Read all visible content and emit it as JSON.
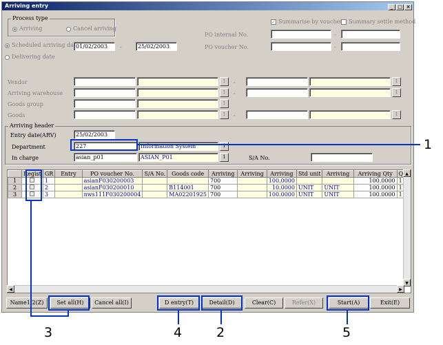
{
  "window": {
    "title": "Arriving entry",
    "controls": {
      "minimize": "_",
      "maximize": "□",
      "close": "×"
    }
  },
  "process_type": {
    "label": "Process type",
    "options": [
      "Arriving",
      "Cancel arriving"
    ],
    "selected": "Arriving"
  },
  "summarise_by_vouchers": {
    "label": "Summarise by vouchers",
    "checked": true
  },
  "summary_settle_method": {
    "label": "Summary settle method",
    "checked": false
  },
  "po_internal_no": {
    "label": "PO internal No.",
    "from": "",
    "to": ""
  },
  "po_voucher_no": {
    "label": "PO voucher No.",
    "from": "",
    "to": ""
  },
  "date_mode": {
    "scheduled_label": "Scheduled arriving date",
    "delivering_label": "Delivering date",
    "selected": "scheduled",
    "from": "01/02/2003",
    "to": "25/02/2003"
  },
  "filters": {
    "vendor_label": "Vendor",
    "arriving_warehouse_label": "Arriving warehouse",
    "goods_group_label": "Goods group",
    "goods_label": "Goods",
    "dash": "-",
    "lookup_glyph": "1"
  },
  "arriving_header": {
    "title": "Arriving header",
    "entry_date_label": "Entry date(ARV)",
    "entry_date": "25/02/2003",
    "department_label": "Department",
    "department_code": "227",
    "department_name": "Information System",
    "in_charge_label": "In charge",
    "in_charge_code": "asian_p01",
    "in_charge_name": "ASIAN_P01",
    "sa_no_label": "S/A No.",
    "sa_no": ""
  },
  "grid": {
    "columns": [
      "Regist",
      "GR",
      "Entry",
      "PO voucher No.",
      "S/A No.",
      "Goods code",
      "Arriving",
      "Arriving",
      "Arriving",
      "Std unit",
      "Arriving",
      "Arriving Qty",
      "Qty"
    ],
    "rows": [
      {
        "num": "1",
        "gr": "1",
        "entry": "",
        "po_voucher": "asianF030200003",
        "sa_no": "",
        "goods_code": "",
        "arriving1": "700",
        "arriving2": "",
        "arriving3": "100.0000",
        "std_unit": "",
        "arriving4": "",
        "qty": "100.0000",
        "qty2": "1"
      },
      {
        "num": "2",
        "gr": "2",
        "entry": "",
        "po_voucher": "asianF030200010",
        "sa_no": "",
        "goods_code": "B114001",
        "arriving1": "700",
        "arriving2": "",
        "arriving3": "10.0000",
        "std_unit": "UNIT",
        "arriving4": "UNIT",
        "qty": "100.0000",
        "qty2": "1"
      },
      {
        "num": "3",
        "gr": "3",
        "entry": "",
        "po_voucher": "nws111F030200004",
        "sa_no": "",
        "goods_code": "MA02201925",
        "arriving1": "700",
        "arriving2": "",
        "arriving3": "100.0000",
        "std_unit": "UNIT",
        "arriving4": "UNIT",
        "qty": "100.0000",
        "qty2": "1"
      }
    ]
  },
  "buttons": {
    "name": "Name1/2(Z)",
    "set_all": "Set all(H)",
    "cancel_all": "Cancel all(I)",
    "d_entry": "D entry(T)",
    "detail": "Detail(D)",
    "clear": "Clear(C)",
    "refer": "Refer(X)",
    "start": "Start(A)",
    "exit": "Exit(E)"
  },
  "callouts": [
    "1",
    "2",
    "3",
    "4",
    "5"
  ],
  "colors": {
    "highlight": "#0033cc",
    "titlebar": "#0a246a",
    "yellow_field": "#ffffe1",
    "link_text": "#0000c0"
  }
}
